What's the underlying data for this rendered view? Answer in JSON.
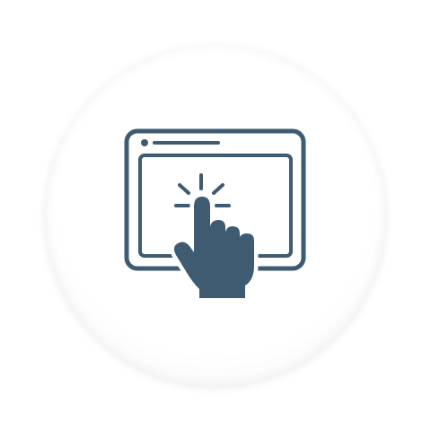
{
  "icon": {
    "name": "touch-screen-tap-icon",
    "color": "#3f5b72",
    "background": "#ffffff"
  }
}
